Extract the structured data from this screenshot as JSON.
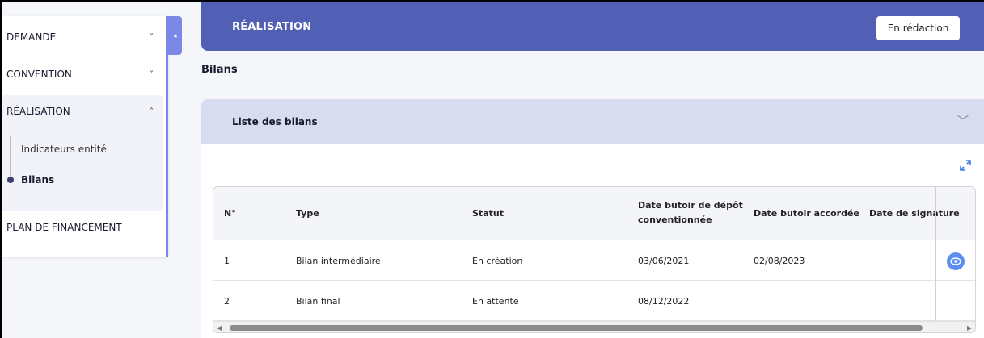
{
  "sidebar": {
    "items": [
      {
        "label": "DEMANDE",
        "chevron": "˅"
      },
      {
        "label": "CONVENTION",
        "chevron": "˅"
      },
      {
        "label": "RÉALISATION",
        "chevron": "˄"
      },
      {
        "label": "PLAN DE FINANCEMENT",
        "chevron": ""
      }
    ],
    "subitems": [
      {
        "label": "Indicateurs entité"
      },
      {
        "label": "Bilans"
      }
    ],
    "collapse_icon": "◂"
  },
  "header": {
    "title": "RÉALISATION",
    "status_label": "En rédaction"
  },
  "section": {
    "title": "Bilans"
  },
  "accordion": {
    "title": "Liste des bilans",
    "chevron": "﹀"
  },
  "table": {
    "columns": [
      "N°",
      "Type",
      "Statut",
      "Date butoir de dépôt conventionnée",
      "Date butoir accordée",
      "Date de signature"
    ],
    "header_line1": "Date butoir de dépôt",
    "header_line2": "conventionnée",
    "rows": [
      {
        "num": "1",
        "type": "Bilan intermédiaire",
        "status": "En création",
        "deadline": "03/06/2021",
        "granted": "02/08/2023",
        "signature": ""
      },
      {
        "num": "2",
        "type": "Bilan final",
        "status": "En attente",
        "deadline": "08/12/2022",
        "granted": "",
        "signature": ""
      }
    ]
  },
  "colors": {
    "accent": "#5160b5",
    "sidebar_border": "#7b88e6",
    "accordion_bg": "#d7dcee",
    "eye_button": "#5b8ef0"
  }
}
